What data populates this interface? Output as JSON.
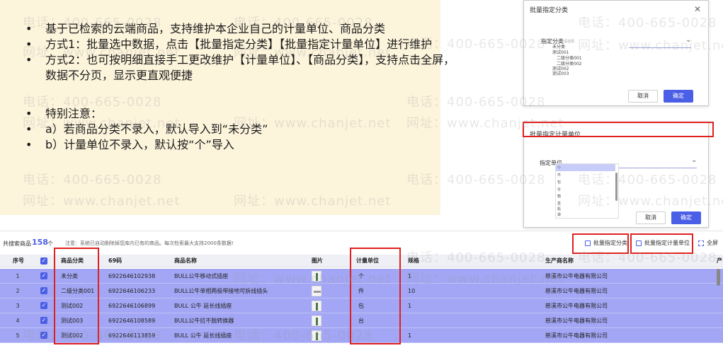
{
  "notes": [
    "基于已检索的云端商品，支持维护本企业自己的计量单位、商品分类",
    "方式1：批量选中数据，点击【批量指定分类】【批量指定计量单位】进行维护",
    "方式2：也可按明细直接手工更改维护【计量单位】、【商品分类】，支持点击全屏，数据不分页，显示更直观便捷",
    "特别注意：",
    "a）若商品分类不录入，默认导入到“未分类”",
    "b）计量单位不录入，默认按“个”导入"
  ],
  "watermark": {
    "phone": "电话：400-665-0028",
    "site": "网址：www.chanjet.net"
  },
  "dialog_category": {
    "title": "批量指定分类",
    "field_label": "指定分类",
    "placeholder": "请选择",
    "tree": [
      "未分类",
      "测试001",
      "二级分类001",
      "二级分类002",
      "测试002",
      "测试003"
    ],
    "cancel": "取消",
    "ok": "确定"
  },
  "dialog_unit": {
    "title": "批量指定计量单位",
    "field_label": "指定单位",
    "options": [
      "个",
      "件",
      "包",
      "台",
      "箱",
      "盒",
      "瓶",
      "袋"
    ],
    "cancel": "取消",
    "ok": "确定"
  },
  "toolbar": {
    "count_label": "共搜索商品",
    "count": "158",
    "count_unit": "个",
    "note": "注意：系统已自动剔除掉您库内已有的商品。每次检索最大支持2000条数据!",
    "batch_category": "批量指定分类",
    "batch_unit": "批量指定计量单位",
    "fullscreen": "全屏"
  },
  "table": {
    "headers": [
      "序号",
      "商品分类",
      "69码",
      "商品名称",
      "图片",
      "计量单位",
      "规格",
      "生产商名称",
      "产"
    ],
    "rows": [
      {
        "seq": "1",
        "category": "未分类",
        "code": "6922646102938",
        "name": "BULL公牛移动式插座",
        "unit": "个",
        "spec": "1",
        "maker": "慈溪市公牛电器有限公司",
        "img": "tall"
      },
      {
        "seq": "2",
        "category": "二级分类001",
        "code": "6922646106233",
        "name": "BULL公牛单相两极带接地可拆线插头",
        "unit": "件",
        "spec": "10",
        "maker": "慈溪市公牛电器有限公司",
        "img": "wide"
      },
      {
        "seq": "3",
        "category": "测试002",
        "code": "6922646106899",
        "name": "BULL 公牛 延长线插座",
        "unit": "包",
        "spec": "1",
        "maker": "慈溪市公牛电器有限公司",
        "img": "tall"
      },
      {
        "seq": "4",
        "category": "测试003",
        "code": "6922646108589",
        "name": "BULL公牛拉不脱转换器",
        "unit": "台",
        "spec": "",
        "maker": "慈溪市公牛电器有限公司",
        "img": "tall"
      },
      {
        "seq": "5",
        "category": "测试002",
        "code": "6922646113859",
        "name": "BULL 公牛 延长线插座",
        "unit": "",
        "spec": "1",
        "maker": "慈溪市公牛电器有限公司",
        "img": "tall"
      }
    ]
  },
  "colors": {
    "accent": "#4b5ee6",
    "row_selected": "#a2a6f4",
    "highlight_box": "#e02020",
    "note_bg": "#fdf4dc"
  }
}
